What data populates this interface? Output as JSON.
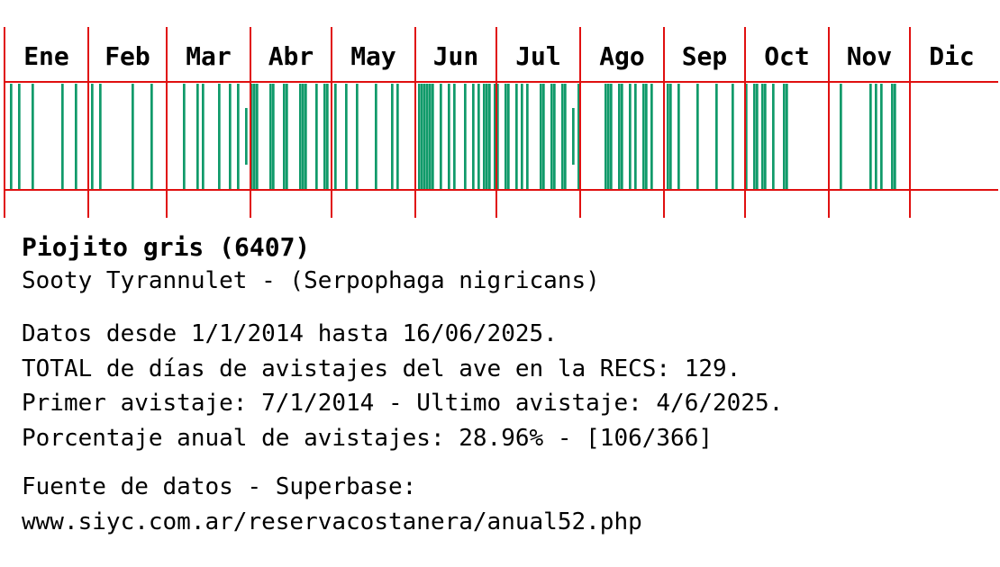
{
  "colors": {
    "grid": "#e01010",
    "bar": "#109a6a",
    "text": "#000000",
    "background": "#ffffff"
  },
  "chart_data": {
    "type": "bar",
    "title": "",
    "xlabel": "",
    "ylabel": "",
    "months": [
      "Ene",
      "Feb",
      "Mar",
      "Abr",
      "May",
      "Jun",
      "Jul",
      "Ago",
      "Sep",
      "Oct",
      "Nov",
      "Dic"
    ],
    "month_days": [
      31,
      29,
      31,
      30,
      31,
      30,
      31,
      31,
      30,
      31,
      30,
      31
    ],
    "day_range": [
      1,
      366
    ],
    "bars": [
      {
        "day": 3,
        "level": "full"
      },
      {
        "day": 6,
        "level": "full"
      },
      {
        "day": 11,
        "level": "full"
      },
      {
        "day": 22,
        "level": "full"
      },
      {
        "day": 27,
        "level": "full"
      },
      {
        "day": 33,
        "level": "full"
      },
      {
        "day": 36,
        "level": "full"
      },
      {
        "day": 48,
        "level": "full"
      },
      {
        "day": 55,
        "level": "full"
      },
      {
        "day": 67,
        "level": "full"
      },
      {
        "day": 72,
        "level": "full"
      },
      {
        "day": 74,
        "level": "full"
      },
      {
        "day": 80,
        "level": "full"
      },
      {
        "day": 84,
        "level": "full"
      },
      {
        "day": 87,
        "level": "full"
      },
      {
        "day": 90,
        "level": "partial"
      },
      {
        "day": 92,
        "level": "full"
      },
      {
        "day": 93,
        "level": "full"
      },
      {
        "day": 94,
        "level": "full"
      },
      {
        "day": 99,
        "level": "full"
      },
      {
        "day": 100,
        "level": "full"
      },
      {
        "day": 104,
        "level": "full"
      },
      {
        "day": 105,
        "level": "full"
      },
      {
        "day": 110,
        "level": "full"
      },
      {
        "day": 111,
        "level": "full"
      },
      {
        "day": 112,
        "level": "full"
      },
      {
        "day": 116,
        "level": "full"
      },
      {
        "day": 119,
        "level": "full"
      },
      {
        "day": 120,
        "level": "full"
      },
      {
        "day": 123,
        "level": "full"
      },
      {
        "day": 127,
        "level": "full"
      },
      {
        "day": 131,
        "level": "full"
      },
      {
        "day": 138,
        "level": "full"
      },
      {
        "day": 144,
        "level": "full"
      },
      {
        "day": 146,
        "level": "full"
      },
      {
        "day": 154,
        "level": "full"
      },
      {
        "day": 155,
        "level": "full"
      },
      {
        "day": 156,
        "level": "full"
      },
      {
        "day": 157,
        "level": "full"
      },
      {
        "day": 158,
        "level": "full"
      },
      {
        "day": 159,
        "level": "full"
      },
      {
        "day": 162,
        "level": "full"
      },
      {
        "day": 165,
        "level": "full"
      },
      {
        "day": 167,
        "level": "full"
      },
      {
        "day": 171,
        "level": "full"
      },
      {
        "day": 174,
        "level": "full"
      },
      {
        "day": 176,
        "level": "full"
      },
      {
        "day": 178,
        "level": "full"
      },
      {
        "day": 179,
        "level": "full"
      },
      {
        "day": 180,
        "level": "full"
      },
      {
        "day": 182,
        "level": "full"
      },
      {
        "day": 183,
        "level": "full"
      },
      {
        "day": 186,
        "level": "full"
      },
      {
        "day": 187,
        "level": "full"
      },
      {
        "day": 190,
        "level": "full"
      },
      {
        "day": 192,
        "level": "full"
      },
      {
        "day": 194,
        "level": "full"
      },
      {
        "day": 199,
        "level": "full"
      },
      {
        "day": 200,
        "level": "full"
      },
      {
        "day": 203,
        "level": "full"
      },
      {
        "day": 204,
        "level": "full"
      },
      {
        "day": 207,
        "level": "full"
      },
      {
        "day": 208,
        "level": "full"
      },
      {
        "day": 211,
        "level": "partial"
      },
      {
        "day": 213,
        "level": "full"
      },
      {
        "day": 223,
        "level": "full"
      },
      {
        "day": 224,
        "level": "full"
      },
      {
        "day": 225,
        "level": "full"
      },
      {
        "day": 228,
        "level": "full"
      },
      {
        "day": 229,
        "level": "full"
      },
      {
        "day": 232,
        "level": "full"
      },
      {
        "day": 234,
        "level": "full"
      },
      {
        "day": 237,
        "level": "full"
      },
      {
        "day": 238,
        "level": "full"
      },
      {
        "day": 240,
        "level": "full"
      },
      {
        "day": 246,
        "level": "full"
      },
      {
        "day": 247,
        "level": "full"
      },
      {
        "day": 250,
        "level": "full"
      },
      {
        "day": 257,
        "level": "full"
      },
      {
        "day": 264,
        "level": "full"
      },
      {
        "day": 270,
        "level": "full"
      },
      {
        "day": 275,
        "level": "full"
      },
      {
        "day": 278,
        "level": "full"
      },
      {
        "day": 279,
        "level": "full"
      },
      {
        "day": 281,
        "level": "full"
      },
      {
        "day": 282,
        "level": "full"
      },
      {
        "day": 285,
        "level": "full"
      },
      {
        "day": 289,
        "level": "full"
      },
      {
        "day": 290,
        "level": "full"
      },
      {
        "day": 310,
        "level": "full"
      },
      {
        "day": 321,
        "level": "full"
      },
      {
        "day": 323,
        "level": "full"
      },
      {
        "day": 325,
        "level": "full"
      },
      {
        "day": 329,
        "level": "full"
      },
      {
        "day": 330,
        "level": "full"
      }
    ]
  },
  "info": {
    "title": "Piojito gris (6407)",
    "subtitle": "Sooty Tyrannulet - (Serpophaga nigricans)",
    "line1": "Datos desde 1/1/2014 hasta 16/06/2025.",
    "line2": "TOTAL de días de avistajes del ave en la RECS: 129.",
    "line3": "Primer avistaje: 7/1/2014 - Ultimo avistaje: 4/6/2025.",
    "line4": "Porcentaje anual de avistajes: 28.96% - [106/366]",
    "source_label": "Fuente de datos - Superbase:",
    "source_url": "www.siyc.com.ar/reservacostanera/anual52.php"
  }
}
